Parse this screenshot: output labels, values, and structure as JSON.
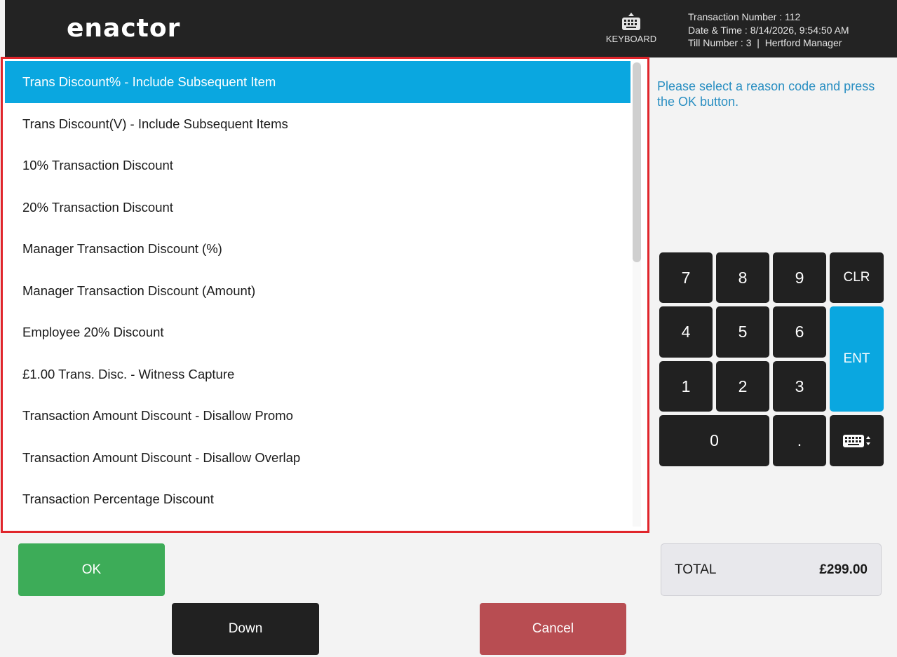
{
  "header": {
    "logo_text": "enactor",
    "keyboard_label": "KEYBOARD",
    "keyboard_icon": "keyboard-icon",
    "transaction_number": "Transaction Number : 112",
    "date_time": "Date & Time : 8/14/2026, 9:54:50 AM",
    "till_info": "Till Number : 3  |  Hertford Manager"
  },
  "reason_list": {
    "items": [
      {
        "label": "Trans Discount% - Include Subsequent Item",
        "selected": true
      },
      {
        "label": "Trans Discount(V) - Include Subsequent Items"
      },
      {
        "label": "10% Transaction Discount"
      },
      {
        "label": "20% Transaction Discount"
      },
      {
        "label": "Manager Transaction Discount (%)"
      },
      {
        "label": "Manager Transaction Discount (Amount)"
      },
      {
        "label": "Employee 20% Discount"
      },
      {
        "label": "£1.00 Trans. Disc. - Witness Capture"
      },
      {
        "label": "Transaction Amount Discount - Disallow Promo"
      },
      {
        "label": "Transaction Amount Discount - Disallow Overlap"
      },
      {
        "label": "Transaction Percentage Discount"
      }
    ]
  },
  "prompt": "Please select a reason code and press the OK button.",
  "keypad": {
    "k7": "7",
    "k8": "8",
    "k9": "9",
    "clr": "CLR",
    "k4": "4",
    "k5": "5",
    "k6": "6",
    "ent": "ENT",
    "k1": "1",
    "k2": "2",
    "k3": "3",
    "k0": "0",
    "dot": ".",
    "toggle_icon": "keyboard-toggle-icon"
  },
  "buttons": {
    "ok": "OK",
    "down": "Down",
    "cancel": "Cancel"
  },
  "total": {
    "label": "TOTAL",
    "value": "£299.00"
  },
  "colors": {
    "accent": "#0aa7e0",
    "ok": "#3dac58",
    "cancel": "#b84d52",
    "header": "#232323",
    "highlight_border": "#e0252b"
  }
}
